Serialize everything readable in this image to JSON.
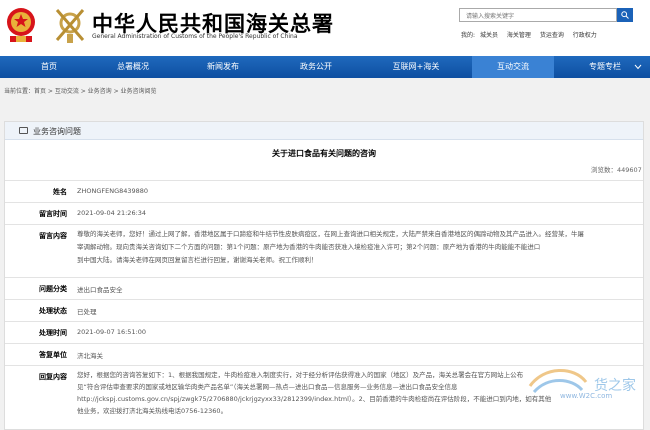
{
  "header": {
    "title_cn": "中华人民共和国海关总署",
    "title_en": "General Administration of Customs of the People's Republic of China",
    "search_placeholder": "请输入搜索关键字",
    "quick_label": "我的:",
    "quick_links": [
      "城关员",
      "海关管理",
      "货运查询",
      "行政权力"
    ]
  },
  "nav": {
    "items": [
      "首页",
      "总署概况",
      "新闻发布",
      "政务公开",
      "互联网+海关",
      "互动交流",
      "专题专栏"
    ],
    "active": "互动交流"
  },
  "breadcrumb": "当前位置：首页 > 互动交流 > 业务咨询 > 业务咨询阅览",
  "panel": {
    "title": "业务咨询问题",
    "question_title": "关于进口食品有关问题的咨询",
    "views_label": "浏览数：449607"
  },
  "fields": {
    "name_label": "姓名",
    "name_value": "ZHONGFENG8439880",
    "time_label": "留言时间",
    "time_value": "2021-09-04 21:26:34",
    "content_label": "留言内容",
    "content_lines": [
      "尊敬的海关老师，您好！通过上网了解，香港地区属于口蹄疫和牛结节性皮肤病疫区，在网上查询进口相关规定，大陆严禁来自香港地区的偶蹄动物及其产品进入。经营某，牛屠",
      "宰调解动物。现向贵海关咨询如下二个方面的问题：第1个问题：原产地为香港的牛肉能否获准入境检疫准入许可；第2个问题：原产地为香港的牛肉能能不能进口",
      "到中国大陆。请海关老师在网页回复留言栏进行回复，谢谢海关老师。祝工作顺利！"
    ],
    "category_label": "问题分类",
    "category_value": "进出口食品安全",
    "status_label": "处理状态",
    "status_value": "已处理",
    "reply_time_label": "处理时间",
    "reply_time_value": "2021-09-07 16:51:00",
    "unit_label": "答复单位",
    "unit_value": "济北海关",
    "reply_label": "回复内容",
    "reply_lines": [
      "您好，根据您的咨询答复如下：1、根据我国规定，牛肉检疫准入制度实行，对于经分析评估获得准入的国家（地区）及产品，海关总署会在官方网站上公布",
      "见“符合评估审查要求的国家或地区输华肉类产品名单”（海关总署网—热点—进出口食品—信息服务—业务信息—进出口食品安全信息",
      "http://jckspj.customs.gov.cn/spj/zwgk75/2706880/jckrjgzyxx33/2812399/index.html）。2、目前香港的牛肉检疫尚在评估阶段，不能进口到内地，如有其他",
      "他业务，欢迎拨打济北海关热线电话0756-12360。"
    ]
  },
  "watermark": {
    "brand": "货之家",
    "url": "www.W2C.com"
  },
  "colors": {
    "nav_blue": "#1f69bd",
    "nav_active": "#3a82d4",
    "title_red": "#c8161d"
  }
}
